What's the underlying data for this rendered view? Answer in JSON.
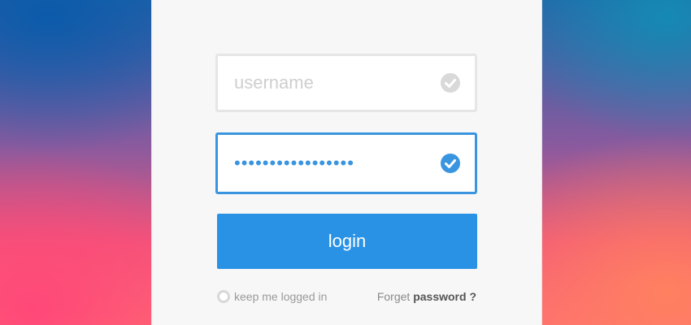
{
  "login_form": {
    "username": {
      "placeholder": "username",
      "value": "",
      "status_icon": "check-circle-icon",
      "status_color": "#d9d9d9"
    },
    "password": {
      "value": "•••••••••••••••••",
      "status_icon": "check-circle-icon",
      "status_color": "#3a95e0"
    },
    "login_label": "login",
    "remember_label": "keep me logged in",
    "forgot_prefix": "Forget",
    "forgot_emphasis": "password ?"
  },
  "colors": {
    "accent": "#2992e4",
    "focus_border": "#3a95e0",
    "card_background": "#f7f7f7"
  }
}
